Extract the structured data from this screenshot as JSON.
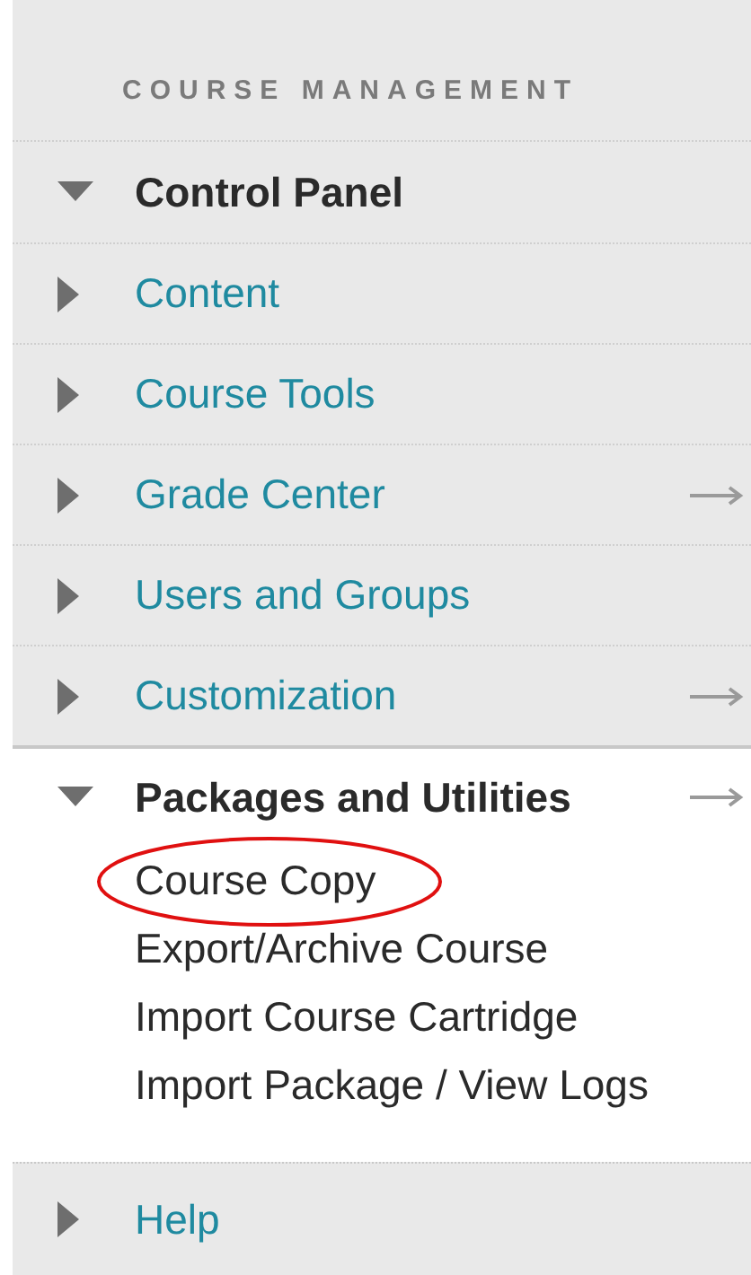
{
  "heading": "COURSE MANAGEMENT",
  "menu": [
    {
      "label": "Control Panel",
      "expanded": true,
      "has_arrow": false,
      "children": [
        {
          "label": "Content",
          "expanded": false,
          "has_arrow": false
        },
        {
          "label": "Course Tools",
          "expanded": false,
          "has_arrow": false
        },
        {
          "label": "Grade Center",
          "expanded": false,
          "has_arrow": true
        },
        {
          "label": "Users and Groups",
          "expanded": false,
          "has_arrow": false
        },
        {
          "label": "Customization",
          "expanded": false,
          "has_arrow": true
        },
        {
          "label": "Packages and Utilities",
          "expanded": true,
          "has_arrow": true,
          "links": [
            {
              "label": "Course Copy",
              "highlighted": true
            },
            {
              "label": "Export/Archive Course",
              "highlighted": false
            },
            {
              "label": "Import Course Cartridge",
              "highlighted": false
            },
            {
              "label": "Import Package / View Logs",
              "highlighted": false
            }
          ]
        }
      ]
    },
    {
      "label": "Help",
      "expanded": false,
      "has_arrow": false
    }
  ]
}
